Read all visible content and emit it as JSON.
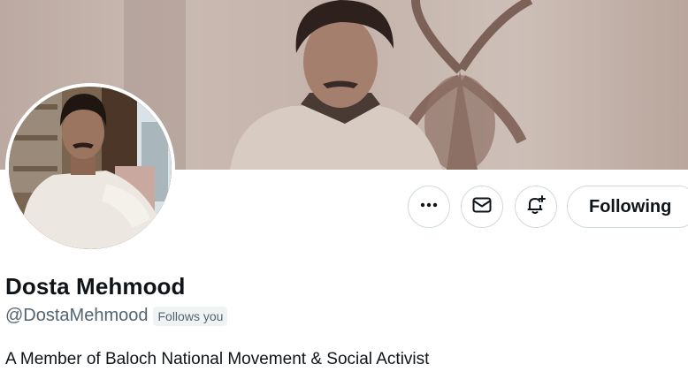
{
  "profile": {
    "display_name": "Dosta Mehmood",
    "handle": "@DostaMehmood",
    "follows_you_badge": "Follows you",
    "bio": "A Member of Baloch National Movement & Social Activist"
  },
  "actions": {
    "more_icon": "more-dots-icon",
    "message_icon": "envelope-icon",
    "notify_icon": "bell-plus-icon",
    "following_label": "Following"
  },
  "colors": {
    "text_primary": "#0f1419",
    "text_secondary": "#536471",
    "border": "#cfd9de",
    "badge_bg": "#eff3f4"
  }
}
